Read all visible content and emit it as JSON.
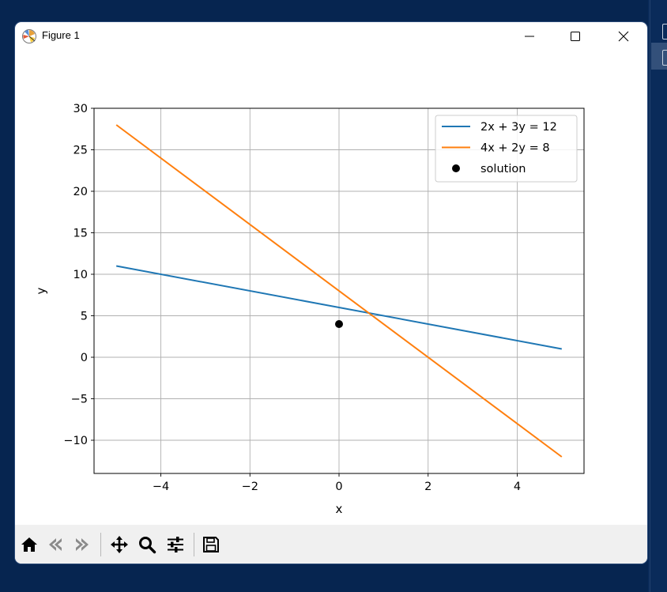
{
  "window": {
    "title": "Figure 1"
  },
  "colors": {
    "series1": "#1f77b4",
    "series2": "#ff7f0e",
    "solution": "#000000",
    "grid": "#b0b0b0"
  },
  "toolbar": {
    "buttons": [
      {
        "name": "home-button",
        "icon": "home-icon"
      },
      {
        "name": "back-button",
        "icon": "back-arrow-icon"
      },
      {
        "name": "forward-button",
        "icon": "forward-arrow-icon"
      },
      {
        "name": "pan-button",
        "icon": "move-icon"
      },
      {
        "name": "zoom-button",
        "icon": "magnifier-icon"
      },
      {
        "name": "configure-subplots-button",
        "icon": "sliders-icon"
      },
      {
        "name": "save-button",
        "icon": "floppy-disk-icon"
      }
    ]
  },
  "chart_data": {
    "type": "line",
    "xlabel": "x",
    "ylabel": "y",
    "xlim": [
      -5.5,
      5.5
    ],
    "ylim": [
      -14.0,
      30.0
    ],
    "xticks": [
      -4,
      -2,
      0,
      2,
      4
    ],
    "yticks": [
      -10,
      -5,
      0,
      5,
      10,
      15,
      20,
      25,
      30
    ],
    "xtick_labels": [
      "−4",
      "−2",
      "0",
      "2",
      "4"
    ],
    "ytick_labels": [
      "−10",
      "−5",
      "0",
      "5",
      "10",
      "15",
      "20",
      "25",
      "30"
    ],
    "grid": true,
    "legend_position": "top-right",
    "series": [
      {
        "name": "2x + 3y = 12",
        "kind": "line",
        "x": [
          -5,
          5
        ],
        "y": [
          11.0,
          1.0
        ]
      },
      {
        "name": "4x + 2y = 8",
        "kind": "line",
        "x": [
          -5,
          5
        ],
        "y": [
          28.0,
          -12.0
        ]
      },
      {
        "name": "solution",
        "kind": "point",
        "x": [
          0
        ],
        "y": [
          4
        ]
      }
    ]
  }
}
